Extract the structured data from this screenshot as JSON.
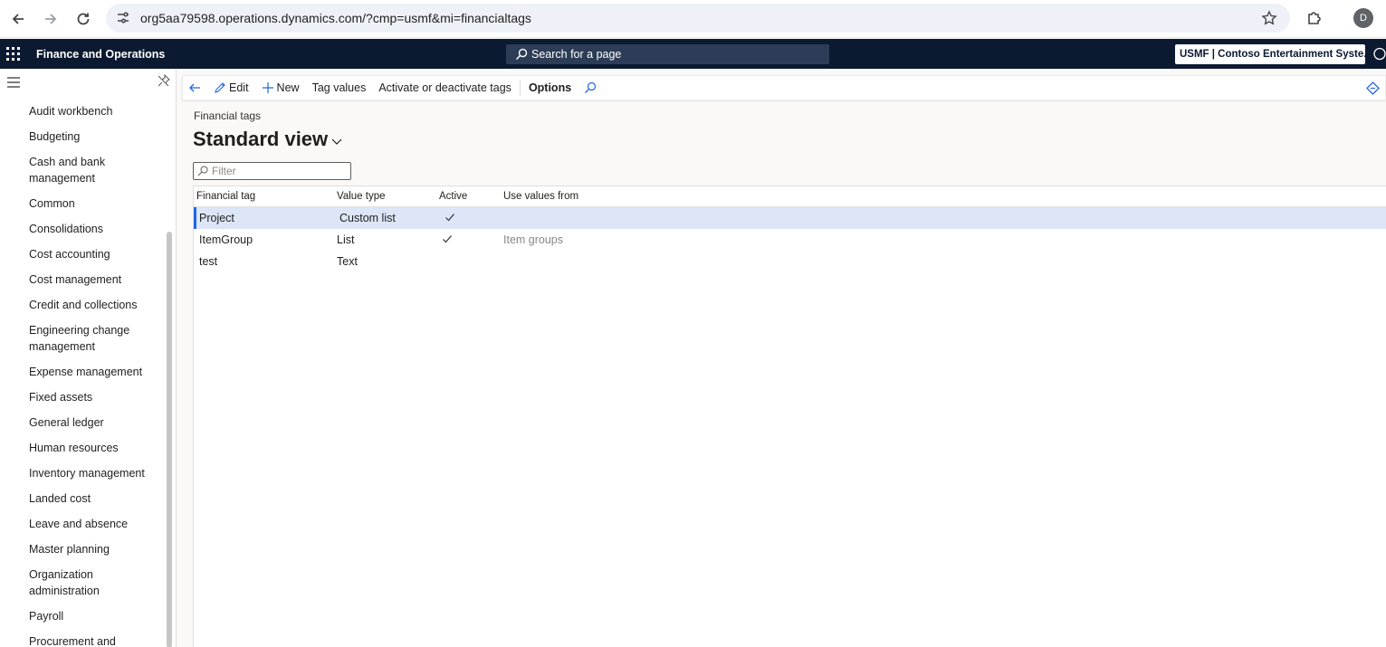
{
  "browser": {
    "url": "org5aa79598.operations.dynamics.com/?cmp=usmf&mi=financialtags",
    "profile_initial": "D"
  },
  "topbar": {
    "app_title": "Finance and Operations",
    "search_label": "Search for a page",
    "company": "USMF | Contoso Entertainment Syste..."
  },
  "sidebar": {
    "items": [
      "Audit workbench",
      "Budgeting",
      "Cash and bank management",
      "Common",
      "Consolidations",
      "Cost accounting",
      "Cost management",
      "Credit and collections",
      "Engineering change management",
      "Expense management",
      "Fixed assets",
      "General ledger",
      "Human resources",
      "Inventory management",
      "Landed cost",
      "Leave and absence",
      "Master planning",
      "Organization administration",
      "Payroll",
      "Procurement and"
    ]
  },
  "actionpane": {
    "edit": "Edit",
    "new": "New",
    "tag_values": "Tag values",
    "activate": "Activate or deactivate tags",
    "options": "Options"
  },
  "page": {
    "caption": "Financial tags",
    "view_name": "Standard view",
    "filter_placeholder": "Filter"
  },
  "grid": {
    "columns": [
      "Financial tag",
      "Value type",
      "Active",
      "Use values from"
    ],
    "rows": [
      {
        "tag": "Project",
        "type": "Custom list",
        "active": true,
        "from": ""
      },
      {
        "tag": "ItemGroup",
        "type": "List",
        "active": true,
        "from": "Item groups"
      },
      {
        "tag": "test",
        "type": "Text",
        "active": false,
        "from": ""
      }
    ]
  },
  "colors": {
    "topbar": "#0b1a31",
    "selection": "#dce6f7",
    "accent": "#2266e3"
  }
}
